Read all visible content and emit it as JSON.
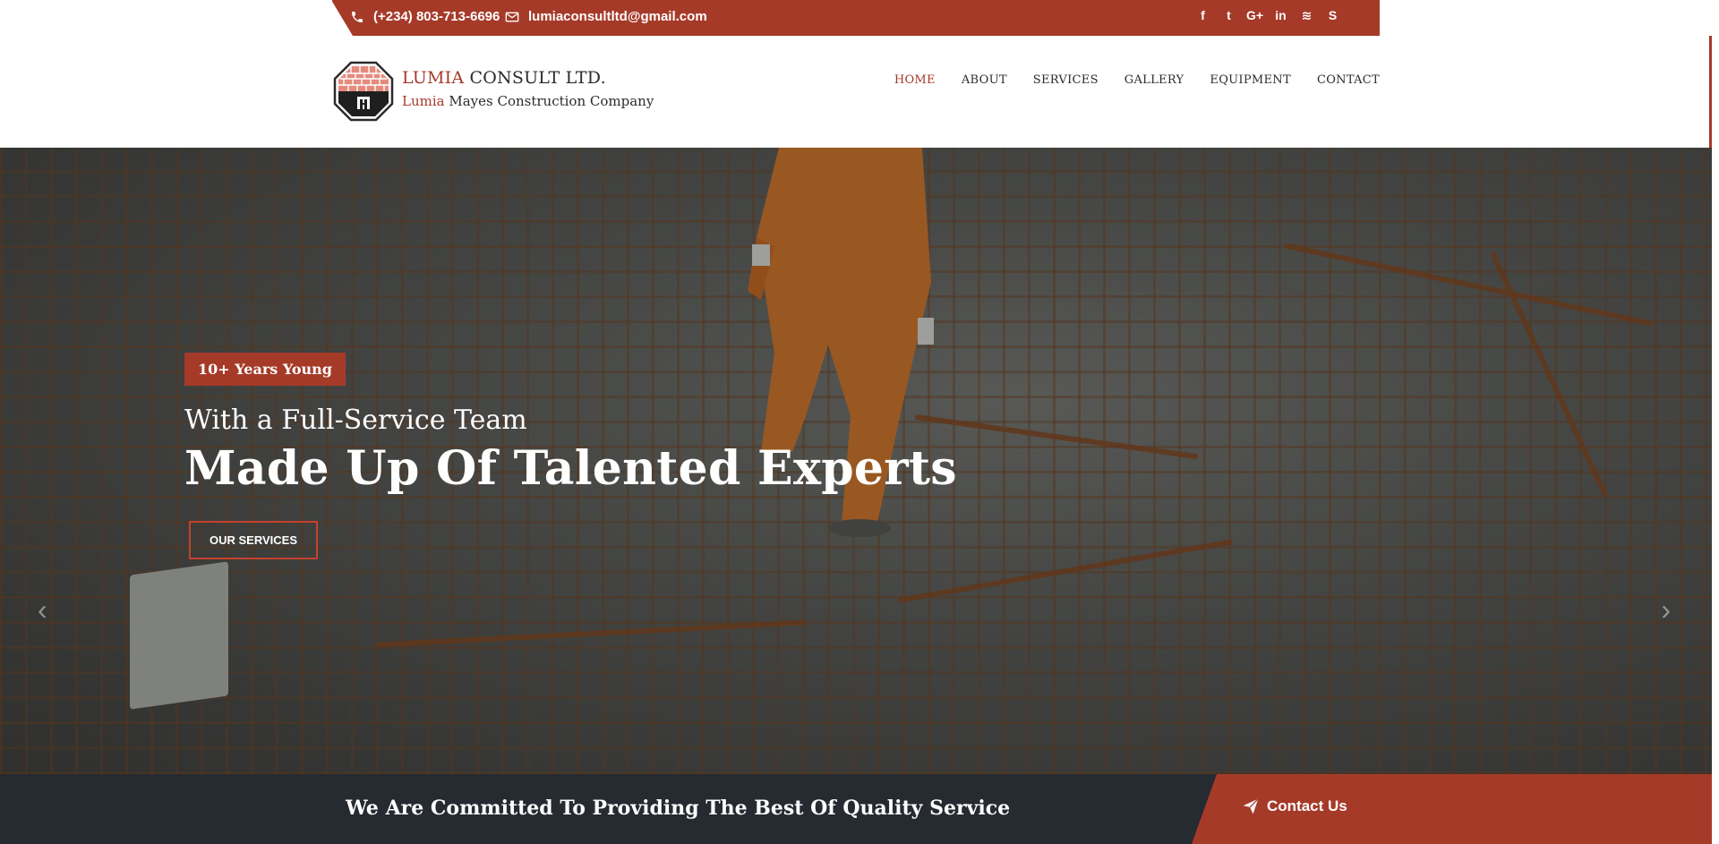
{
  "topbar": {
    "phone": "(+234) 803-713-6696",
    "email": "lumiaconsultltd@gmail.com",
    "social": [
      {
        "name": "facebook-icon",
        "glyph": "f"
      },
      {
        "name": "twitter-icon",
        "glyph": "t"
      },
      {
        "name": "google-plus-icon",
        "glyph": "G+"
      },
      {
        "name": "linkedin-icon",
        "glyph": "in"
      },
      {
        "name": "rss-icon",
        "glyph": "≋"
      },
      {
        "name": "skype-icon",
        "glyph": "S"
      }
    ]
  },
  "brand": {
    "title_accent": "LUMIA",
    "title_rest": " CONSULT LTD.",
    "subtitle_accent": "Lumia",
    "subtitle_rest": " Mayes Construction Company"
  },
  "nav": {
    "items": [
      "HOME",
      "ABOUT",
      "SERVICES",
      "GALLERY",
      "EQUIPMENT",
      "CONTACT"
    ],
    "active": "HOME"
  },
  "hero": {
    "badge": "10+ Years Young",
    "subtitle": "With a Full-Service Team",
    "title": "Made Up Of Talented Experts",
    "button": "OUR SERVICES"
  },
  "bottombar": {
    "text": "We Are Committed To Providing The Best Of Quality Service",
    "contact": "Contact Us"
  },
  "colors": {
    "accent": "#a63a29",
    "dark": "#262a31"
  }
}
